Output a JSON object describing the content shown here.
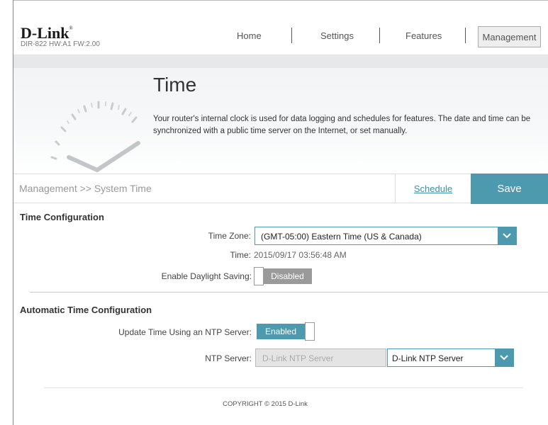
{
  "header": {
    "brand": "D-Link",
    "model": "DIR-822 HW:A1 FW:2.00",
    "nav": [
      {
        "label": "Home"
      },
      {
        "label": "Settings"
      },
      {
        "label": "Features"
      },
      {
        "label": "Management",
        "active": true
      }
    ]
  },
  "banner": {
    "title": "Time",
    "description_line1": "Your router's internal clock is used for data logging and schedules for features. The date and time can be",
    "description_line2": "synchronized with a public time server on the Internet, or set manually."
  },
  "breadcrumb": "Management >> System Time",
  "actions": {
    "schedule_label": "Schedule",
    "save_label": "Save"
  },
  "time_config": {
    "title": "Time Configuration",
    "timezone_label": "Time Zone:",
    "timezone_value": "(GMT-05:00) Eastern Time (US & Canada)",
    "time_label": "Time:",
    "time_value": "2015/09/17 03:56:48 AM",
    "dst_label": "Enable Daylight Saving:",
    "dst_state": "Disabled"
  },
  "auto_time": {
    "title": "Automatic Time Configuration",
    "ntp_update_label": "Update Time Using an NTP Server:",
    "ntp_update_state": "Enabled",
    "ntp_server_label": "NTP Server:",
    "ntp_server_input_value": "D-Link NTP Server",
    "ntp_server_select_value": "D-Link NTP Server"
  },
  "footer": {
    "copyright": "COPYRIGHT © 2015 D-Link"
  },
  "colors": {
    "accent": "#4d99ad",
    "disabled_toggle": "#9a9a9a",
    "link": "#3d8fa5"
  }
}
